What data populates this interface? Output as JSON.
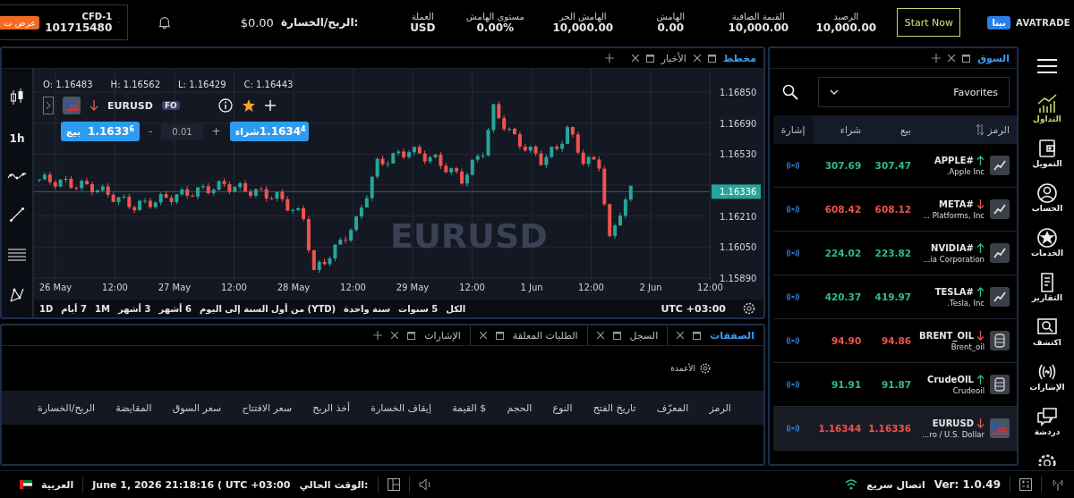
{
  "top_bar": {
    "promo_badge": "عرض ت",
    "account": {
      "type": "CFD-1",
      "number": "101715480"
    },
    "pnl": {
      "label": "الربح/الخسارة:",
      "value": "$0.00"
    },
    "stats": [
      {
        "label": "الرصيد",
        "value": "10,000.00"
      },
      {
        "label": "القيمة الصافية",
        "value": "10,000.00"
      },
      {
        "label": "الهامش",
        "value": "0.00"
      },
      {
        "label": "الهامش الحر",
        "value": "10,000.00"
      },
      {
        "label": "مستوى الهامش",
        "value": "0.00%"
      },
      {
        "label": "العملة",
        "value": "USD"
      }
    ],
    "start_button": "Start Now",
    "beta_badge": "بيتا",
    "brand": "AVATRADE"
  },
  "chart_panel": {
    "tabs": [
      {
        "label": "مخطط",
        "selected": true
      },
      {
        "label": "الأخبار",
        "selected": false
      }
    ],
    "ohlc": [
      {
        "label": "C:",
        "value": "1.16443"
      },
      {
        "label": "L:",
        "value": "1.16429"
      },
      {
        "label": "H:",
        "value": "1.16562"
      },
      {
        "label": "O:",
        "value": "1.16483"
      }
    ],
    "symbol": "EURUSD",
    "symbol_badge": "FO",
    "timeframe": "1h",
    "sell": {
      "label": "بيع",
      "price": "1.1633$^{6}$"
    },
    "quantity": "0.01",
    "minus": "-",
    "plus": "+",
    "buy": {
      "label": "شراء",
      "price": "1.1634$^{4}$"
    },
    "watermark": "EURUSD",
    "y_ticks": [
      "1.16850",
      "1.16690",
      "1.16530",
      "1.16210",
      "1.16050",
      "1.15890"
    ],
    "current_price": "1.16336",
    "x_ticks": [
      "12:00",
      "2 Jun",
      "12:00",
      "1 Jun",
      "12:00",
      "29 May",
      "12:00",
      "28 May",
      "12:00",
      "27 May",
      "12:00",
      "26 May"
    ],
    "ranges": [
      "الكل",
      "5 سنوات",
      "سنة واحدة",
      "(YTD) من أول السنة إلى اليوم",
      "6 أشهر",
      "3 أشهر",
      "1M",
      "7 أيام",
      "1D"
    ],
    "timezone": "UTC +03:00"
  },
  "positions_panel": {
    "tabs": [
      {
        "label": "الصفقات",
        "selected": true
      },
      {
        "label": "السجل",
        "selected": false
      },
      {
        "label": "الطلبات المعلقة",
        "selected": false
      },
      {
        "label": "الإشارات",
        "selected": false
      }
    ],
    "columns_button": "الأعمدة",
    "columns": [
      "الرمز",
      "المعرّف",
      "تاريخ الفتح",
      "النوع",
      "الحجم",
      "القيمة $",
      "إيقاف الخسارة",
      "أخذ الربح",
      "سعر الافتتاح",
      "سعر السوق",
      "المقايضة",
      "الربح/الخسارة"
    ]
  },
  "market_panel": {
    "tab": {
      "label": "السوق",
      "selected": true
    },
    "list_select": "Favorites",
    "columns": [
      "الرمز",
      "بيع",
      "شراء",
      "إشارة"
    ],
    "rows": [
      {
        "symbol": "APPLE#",
        "name": ".Apple Inc",
        "rising": true,
        "sell": "307.47",
        "buy": "307.69",
        "kind": "stock",
        "selected": false
      },
      {
        "symbol": "META#",
        "name": "... Platforms, Inc",
        "rising": false,
        "sell": "608.12",
        "buy": "608.42",
        "kind": "stock",
        "selected": false
      },
      {
        "symbol": "NVIDIA#",
        "name": "...ia Corporation",
        "rising": true,
        "sell": "223.82",
        "buy": "224.02",
        "kind": "stock",
        "selected": false
      },
      {
        "symbol": "TESLA#",
        "name": ".Tesla, Inc",
        "rising": true,
        "sell": "419.97",
        "buy": "420.37",
        "kind": "stock",
        "selected": false
      },
      {
        "symbol": "BRENT_OIL",
        "name": "Brent_oil",
        "rising": false,
        "sell": "94.86",
        "buy": "94.90",
        "kind": "commodity",
        "selected": false
      },
      {
        "symbol": "CrudeOIL",
        "name": "Crudeoil",
        "rising": true,
        "sell": "91.87",
        "buy": "91.91",
        "kind": "commodity",
        "selected": false
      },
      {
        "symbol": "EURUSD",
        "name": "...ro / U.S. Dollar",
        "rising": false,
        "sell": "1.16336",
        "buy": "1.16344",
        "kind": "forex",
        "selected": true
      }
    ]
  },
  "side_nav": [
    {
      "label": "التداول",
      "kind": "chart",
      "selected": true
    },
    {
      "label": "التمويل",
      "kind": "wallet",
      "selected": false
    },
    {
      "label": "الحساب",
      "kind": "user",
      "selected": false
    },
    {
      "label": "الخدمات",
      "kind": "star",
      "selected": false
    },
    {
      "label": "التقارير",
      "kind": "report",
      "selected": false
    },
    {
      "label": "اكتشف",
      "kind": "discover",
      "selected": false
    },
    {
      "label": "الإشارات",
      "kind": "signal",
      "selected": false
    },
    {
      "label": "دردشة",
      "kind": "chat",
      "selected": false
    }
  ],
  "status_bar": {
    "language": "العربية",
    "time_label": "الوقت الحالي:",
    "time_value": "June 1, 2026 21:18:16 ( UTC +03:00",
    "connection": "اتصال سريع",
    "version": "Ver: 1.0.49"
  }
}
